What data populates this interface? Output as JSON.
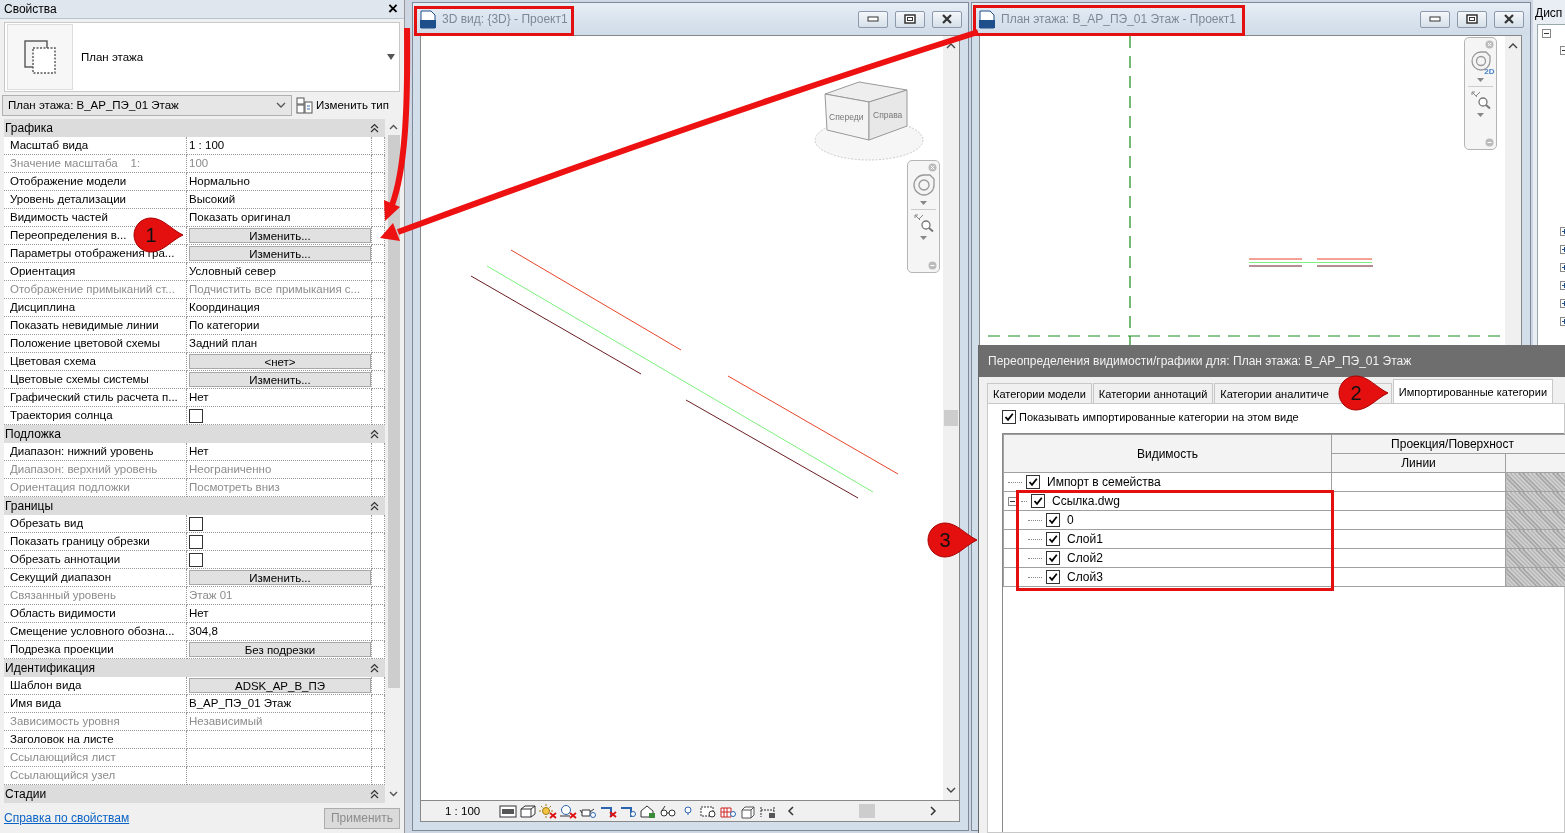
{
  "properties_panel": {
    "title": "Свойства",
    "close": "×",
    "type_name": "План этажа",
    "instance": "План этажа: В_АР_ПЭ_01 Этаж",
    "edit_type": "Изменить тип",
    "sections": [
      {
        "name": "Графика",
        "expanded": true,
        "rows": [
          {
            "label": "Масштаб вида",
            "value": "1 : 100",
            "kind": "text",
            "disabled": false
          },
          {
            "label": "Значение масштаба    1:",
            "value": "100",
            "kind": "text",
            "disabled": true
          },
          {
            "label": "Отображение модели",
            "value": "Нормально",
            "kind": "text",
            "disabled": false
          },
          {
            "label": "Уровень детализации",
            "value": "Высокий",
            "kind": "text",
            "disabled": false
          },
          {
            "label": "Видимость частей",
            "value": "Показать оригинал",
            "kind": "text",
            "disabled": false
          },
          {
            "label": "Переопределения в...",
            "value": "Изменить...",
            "kind": "button",
            "disabled": false
          },
          {
            "label": "Параметры отображения гра...",
            "value": "Изменить...",
            "kind": "button",
            "disabled": false
          },
          {
            "label": "Ориентация",
            "value": "Условный север",
            "kind": "text",
            "disabled": false
          },
          {
            "label": "Отображение примыканий ст...",
            "value": "Подчистить все примыкания с...",
            "kind": "text",
            "disabled": true
          },
          {
            "label": "Дисциплина",
            "value": "Координация",
            "kind": "text",
            "disabled": false
          },
          {
            "label": "Показать невидимые линии",
            "value": "По категории",
            "kind": "text",
            "disabled": false
          },
          {
            "label": "Положение цветовой схемы",
            "value": "Задний план",
            "kind": "text",
            "disabled": false
          },
          {
            "label": "Цветовая схема",
            "value": "<нет>",
            "kind": "button",
            "disabled": false
          },
          {
            "label": "Цветовые схемы системы",
            "value": "Изменить...",
            "kind": "button",
            "disabled": false
          },
          {
            "label": "Графический стиль расчета п...",
            "value": "Нет",
            "kind": "text",
            "disabled": false
          },
          {
            "label": "Траектория солнца",
            "kind": "checkbox",
            "checked": false,
            "disabled": false
          }
        ]
      },
      {
        "name": "Подложка",
        "expanded": true,
        "rows": [
          {
            "label": "Диапазон: нижний уровень",
            "value": "Нет",
            "kind": "text",
            "disabled": false
          },
          {
            "label": "Диапазон: верхний уровень",
            "value": "Неограниченно",
            "kind": "text",
            "disabled": true
          },
          {
            "label": "Ориентация подложки",
            "value": "Посмотреть вниз",
            "kind": "text",
            "disabled": true
          }
        ]
      },
      {
        "name": "Границы",
        "expanded": true,
        "rows": [
          {
            "label": "Обрезать вид",
            "kind": "checkbox",
            "checked": false,
            "disabled": false
          },
          {
            "label": "Показать границу обрезки",
            "kind": "checkbox",
            "checked": false,
            "disabled": false
          },
          {
            "label": "Обрезать аннотации",
            "kind": "checkbox",
            "checked": false,
            "disabled": false
          },
          {
            "label": "Секущий диапазон",
            "value": "Изменить...",
            "kind": "button",
            "disabled": false
          },
          {
            "label": "Связанный уровень",
            "value": "Этаж 01",
            "kind": "text",
            "disabled": true
          },
          {
            "label": "Область видимости",
            "value": "Нет",
            "kind": "text",
            "disabled": false
          },
          {
            "label": "Смещение условного обозна...",
            "value": "304,8",
            "kind": "text",
            "disabled": false
          },
          {
            "label": "Подрезка проекции",
            "value": "Без подрезки",
            "kind": "button",
            "disabled": false
          }
        ]
      },
      {
        "name": "Идентификация",
        "expanded": true,
        "rows": [
          {
            "label": "Шаблон вида",
            "value": "ADSK_АР_В_ПЭ",
            "kind": "button",
            "disabled": false
          },
          {
            "label": "Имя вида",
            "value": "В_АР_ПЭ_01 Этаж",
            "kind": "text",
            "disabled": false
          },
          {
            "label": "Зависимость уровня",
            "value": "Независимый",
            "kind": "text",
            "disabled": true
          },
          {
            "label": "Заголовок на листе",
            "kind": "text",
            "disabled": false
          },
          {
            "label": "Ссылающийся лист",
            "kind": "text",
            "disabled": true
          },
          {
            "label": "Ссылающийся узел",
            "kind": "text",
            "disabled": true
          }
        ]
      },
      {
        "name": "Стадии",
        "expanded": true
      }
    ],
    "help_link": "Справка по свойствам",
    "apply_button": "Применить",
    "apply_disabled": true
  },
  "view_3d": {
    "title": "3D вид: {3D} - Проект1",
    "cube_faces": [
      "Спереди",
      "Справа"
    ],
    "scale": "1 : 100"
  },
  "view_plan": {
    "title": "План этажа: В_АР_ПЭ_01 Этаж - Проект1",
    "nav_mode": "2D"
  },
  "project_browser": {
    "title": "Дисп"
  },
  "dialog": {
    "title": "Переопределения видимости/графики для: План этажа: В_АР_ПЭ_01 Этаж",
    "tabs": [
      {
        "label": "Категории модели",
        "selected": false
      },
      {
        "label": "Категории аннотаций",
        "selected": false
      },
      {
        "label": "Категории аналитиче",
        "selected": false
      },
      {
        "label": "Импортированные категории",
        "selected": true
      }
    ],
    "show_imported": {
      "label": "Показывать импортированные категории на этом виде",
      "checked": true
    },
    "table": {
      "columns": {
        "visibility": "Видимость",
        "projection": "Проекция/Поверхност",
        "lines": "Линии"
      },
      "rows": [
        {
          "name": "Импорт в семейства",
          "checked": true
        },
        {
          "name": "Ссылка.dwg",
          "checked": true,
          "expanded": true,
          "children": [
            {
              "name": "0",
              "checked": true
            },
            {
              "name": "Слой1",
              "checked": true
            },
            {
              "name": "Слой2",
              "checked": true
            },
            {
              "name": "Слой3",
              "checked": true
            }
          ]
        }
      ]
    }
  },
  "callouts": [
    {
      "number": "1"
    },
    {
      "number": "2"
    },
    {
      "number": "3"
    }
  ]
}
